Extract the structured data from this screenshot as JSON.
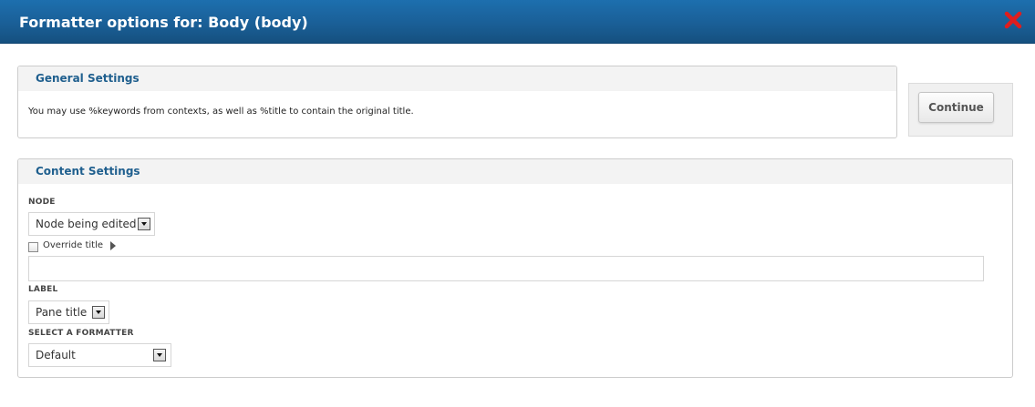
{
  "dialog": {
    "title": "Formatter options for: Body (body)",
    "close_icon": "close-x-icon",
    "close_color": "#e01d1d",
    "header_color": "#1a5f97"
  },
  "general_settings": {
    "legend": "General Settings",
    "description": "You may use %keywords from contexts, as well as %title to contain the original title."
  },
  "actions": {
    "continue_label": "Continue"
  },
  "content_settings": {
    "legend": "Content Settings",
    "node": {
      "label": "NODE",
      "selected": "Node being edited"
    },
    "override_title": {
      "label": "Override title",
      "checked": false,
      "value": ""
    },
    "label_field": {
      "label": "LABEL",
      "selected": "Pane title"
    },
    "formatter": {
      "label": "SELECT A FORMATTER",
      "selected": "Default"
    }
  }
}
